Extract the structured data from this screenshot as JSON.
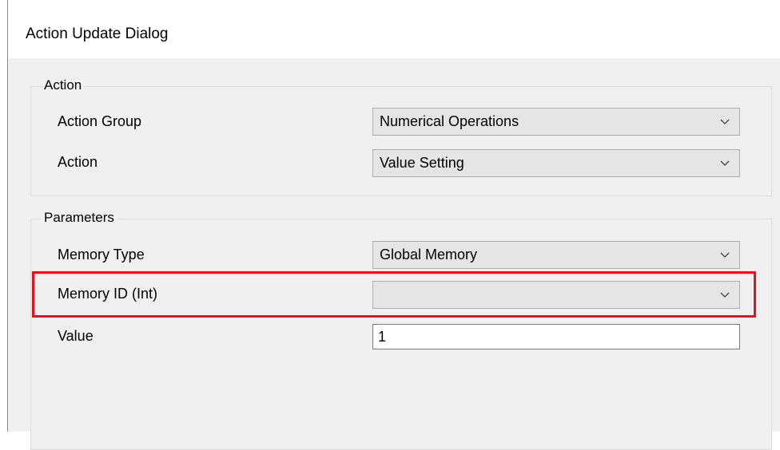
{
  "window": {
    "title": "Action Update Dialog"
  },
  "action_group": {
    "legend": "Action",
    "fields": {
      "action_group_label": "Action Group",
      "action_group_value": "Numerical Operations",
      "action_label": "Action",
      "action_value": "Value Setting"
    }
  },
  "parameters": {
    "legend": "Parameters",
    "memory_type_label": "Memory Type",
    "memory_type_value": "Global Memory",
    "memory_id_label": "Memory ID (Int)",
    "memory_id_value": "",
    "value_label": "Value",
    "value_value": "1"
  },
  "colors": {
    "highlight": "#e8101a",
    "combo_bg": "#e5e5e5",
    "dialog_bg": "#f0f0f0"
  },
  "icons": {
    "dropdown": "chevron-down-icon"
  }
}
